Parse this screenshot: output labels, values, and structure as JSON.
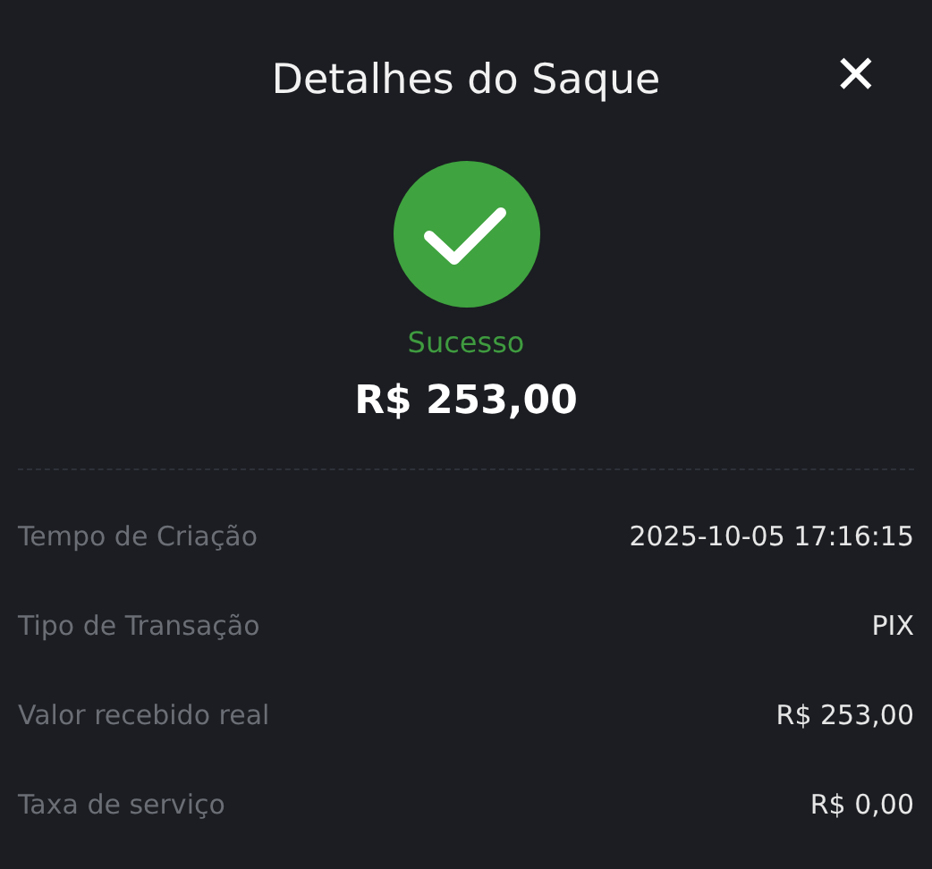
{
  "header": {
    "title": "Detalhes do Saque",
    "close": "✕"
  },
  "status": {
    "kind": "success",
    "label": "Sucesso"
  },
  "amount": "R$ 253,00",
  "details": [
    {
      "label": "Tempo de Criação",
      "value": "2025-10-05 17:16:15"
    },
    {
      "label": "Tipo de Transação",
      "value": "PIX"
    },
    {
      "label": "Valor recebido real",
      "value": "R$ 253,00"
    },
    {
      "label": "Taxa de serviço",
      "value": "R$ 0,00"
    }
  ]
}
